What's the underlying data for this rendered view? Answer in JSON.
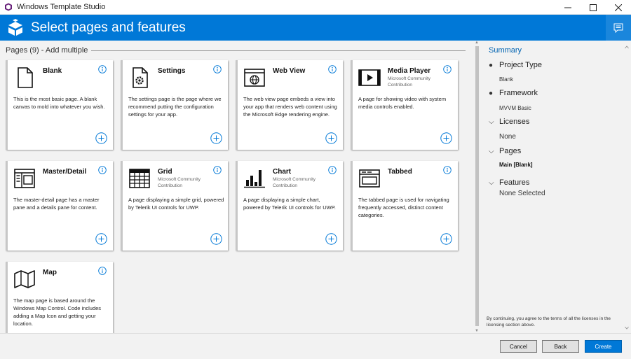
{
  "window": {
    "title": "Windows Template Studio"
  },
  "header": {
    "title": "Select pages and features"
  },
  "pages_section": {
    "title": "Pages (9) - Add multiple"
  },
  "cards": [
    {
      "title": "Blank",
      "author": "",
      "description": "This is the most basic page. A blank canvas to mold into whatever you wish.",
      "icon": "blank-page-icon"
    },
    {
      "title": "Settings",
      "author": "",
      "description": "The settings page is the page where we recommend putting the configuration settings for your app.",
      "icon": "settings-page-icon"
    },
    {
      "title": "Web View",
      "author": "",
      "description": "The web view page embeds a view into your app that renders web content using the Microsoft Edge rendering engine.",
      "icon": "web-view-icon"
    },
    {
      "title": "Media Player",
      "author": "Microsoft Community Contribution",
      "description": "A page for showing video with system media controls enabled.",
      "icon": "media-player-icon"
    },
    {
      "title": "Master/Detail",
      "author": "",
      "description": "The master-detail page has a master pane and a details pane for content.",
      "icon": "master-detail-icon"
    },
    {
      "title": "Grid",
      "author": "Microsoft Community Contribution",
      "description": "A page displaying a simple grid, powered by Telerik UI controls for UWP.",
      "icon": "grid-icon"
    },
    {
      "title": "Chart",
      "author": "Microsoft Community Contribution",
      "description": "A page displaying a simple chart, powered by Telerik UI controls for UWP.",
      "icon": "chart-icon"
    },
    {
      "title": "Tabbed",
      "author": "",
      "description": "The tabbed page is used for navigating frequently accessed, distinct content categories.",
      "icon": "tabbed-icon"
    },
    {
      "title": "Map",
      "author": "",
      "description": "The map page is based around the Windows Map Control. Code includes adding a Map Icon and getting your location.",
      "icon": "map-icon"
    }
  ],
  "summary": {
    "title": "Summary",
    "project_type_label": "Project Type",
    "project_type_value": "Blank",
    "framework_label": "Framework",
    "framework_value": "MVVM Basic",
    "licenses_label": "Licenses",
    "licenses_value": "None",
    "pages_label": "Pages",
    "pages_value": "Main [Blank]",
    "features_label": "Features",
    "features_value": "None Selected",
    "terms": "By continuing, you agree to the terms of all the licenses in the licensing section above."
  },
  "footer": {
    "cancel": "Cancel",
    "back": "Back",
    "create": "Create"
  },
  "colors": {
    "accent": "#0078d7",
    "summary_title": "#0063b1"
  }
}
